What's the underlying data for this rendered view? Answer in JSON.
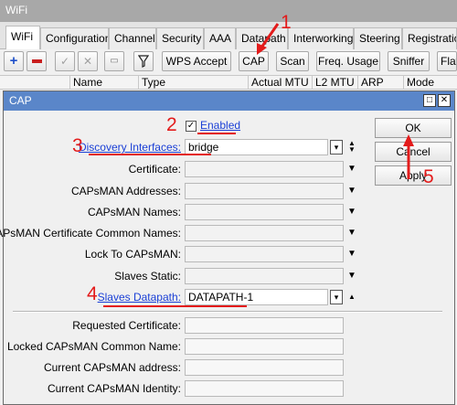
{
  "window": {
    "title": "WiFi"
  },
  "tabs": [
    "WiFi",
    "Configuration",
    "Channel",
    "Security",
    "AAA",
    "Datapath",
    "Interworking",
    "Steering",
    "Registration"
  ],
  "toolbar": {
    "buttons": [
      "WPS Accept",
      "CAP",
      "Scan",
      "Freq. Usage",
      "Sniffer",
      "Flat"
    ]
  },
  "columns": [
    "Name",
    "Type",
    "Actual MTU",
    "L2 MTU",
    "ARP",
    "Mode"
  ],
  "dialog": {
    "title": "CAP",
    "enabled_label": "Enabled",
    "enabled_checked": true,
    "fields": [
      {
        "label": "Discovery Interfaces:",
        "value": "bridge"
      },
      {
        "label": "Certificate:",
        "value": ""
      },
      {
        "label": "CAPsMAN Addresses:",
        "value": ""
      },
      {
        "label": "CAPsMAN Names:",
        "value": ""
      },
      {
        "label": "CAPsMAN Certificate Common Names:",
        "value": ""
      },
      {
        "label": "Lock To CAPsMAN:",
        "value": ""
      },
      {
        "label": "Slaves Static:",
        "value": ""
      },
      {
        "label": "Slaves Datapath:",
        "value": "DATAPATH-1"
      }
    ],
    "readonly_fields": [
      {
        "label": "Requested Certificate:",
        "value": ""
      },
      {
        "label": "Locked CAPsMAN Common Name:",
        "value": ""
      },
      {
        "label": "Current CAPsMAN address:",
        "value": ""
      },
      {
        "label": "Current CAPsMAN Identity:",
        "value": ""
      }
    ],
    "buttons": {
      "ok": "OK",
      "cancel": "Cancel",
      "apply": "Apply"
    }
  },
  "annotations": [
    "1",
    "2",
    "3",
    "4",
    "5"
  ],
  "colors": {
    "annotation": "#e31b1b",
    "dialog_title": "#5a86c9",
    "link": "#1a3fd6"
  }
}
